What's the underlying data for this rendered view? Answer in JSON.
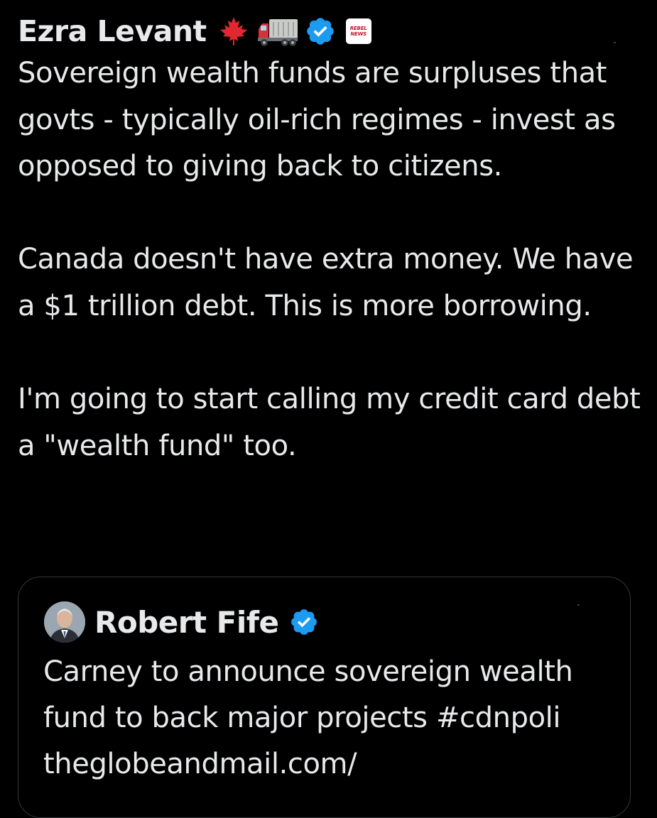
{
  "tweet": {
    "author_name": "Ezra Levant",
    "badges": {
      "leaf_emoji": "🍁",
      "affiliation_label_line1": "REBEL",
      "affiliation_label_line2": "NEWS"
    },
    "icons": {
      "leaf": "maple-leaf-icon",
      "truck": "truck-icon",
      "verified": "verified-badge-icon",
      "affiliation": "rebel-news-logo"
    },
    "text": "Sovereign wealth funds are surpluses that govts - typically oil-rich regimes - invest as opposed to giving back to citizens.\n\nCanada doesn't have extra money. We have a $1 trillion debt. This is more borrowing.\n\nI'm going to start calling my credit card debt a \"wealth fund\" too."
  },
  "quoted_tweet": {
    "author_name": "Robert Fife",
    "icons": {
      "avatar": "avatar",
      "verified": "verified-badge-icon"
    },
    "text": "Carney to announce sovereign wealth fund to back major projects #cdnpoli theglobeandmail.com/"
  },
  "colors": {
    "background": "#000000",
    "text": "#e7e9ea",
    "verified_blue": "#1d9bf0",
    "card_border": "#333639"
  }
}
